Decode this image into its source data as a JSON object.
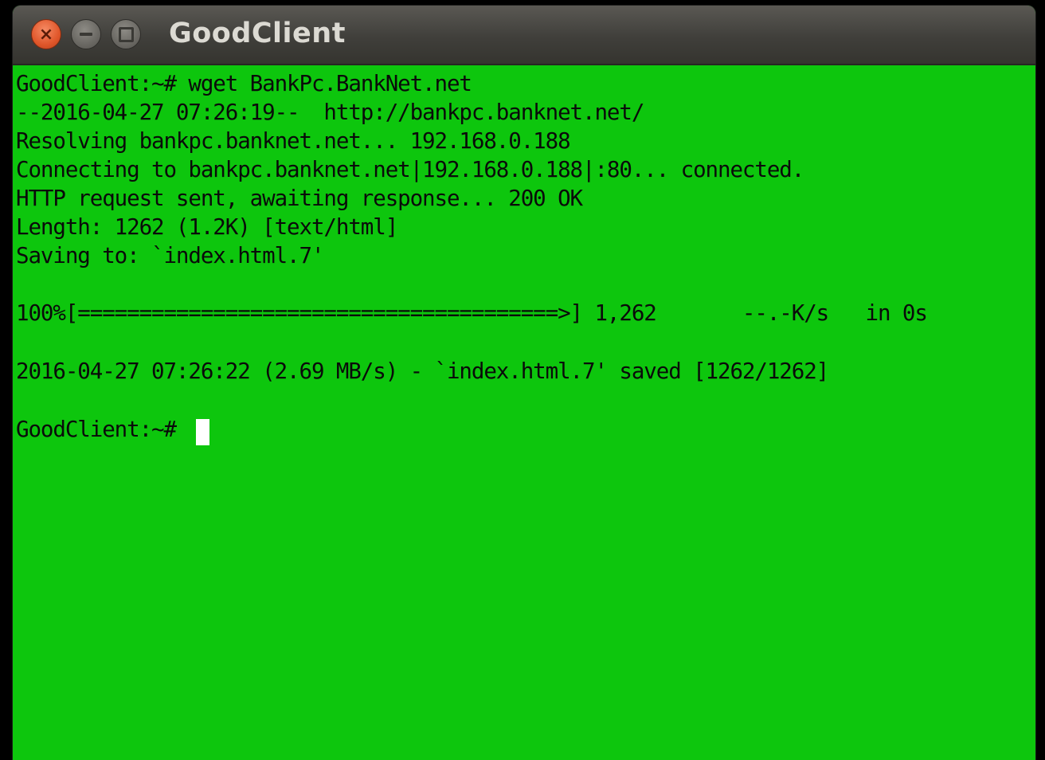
{
  "window": {
    "title": "GoodClient"
  },
  "terminal": {
    "lines": [
      "GoodClient:~# wget BankPc.BankNet.net",
      "--2016-04-27 07:26:19--  http://bankpc.banknet.net/",
      "Resolving bankpc.banknet.net... 192.168.0.188",
      "Connecting to bankpc.banknet.net|192.168.0.188|:80... connected.",
      "HTTP request sent, awaiting response... 200 OK",
      "Length: 1262 (1.2K) [text/html]",
      "Saving to: `index.html.7'",
      "",
      "100%[=======================================>] 1,262       --.-K/s   in 0s",
      "",
      "2016-04-27 07:26:22 (2.69 MB/s) - `index.html.7' saved [1262/1262]",
      "",
      "GoodClient:~# "
    ],
    "download_progress_percent": 100
  },
  "colors": {
    "terminal_background": "#0dc60d",
    "terminal_text": "#0a0a0a",
    "titlebar": "#403f3b",
    "close_button": "#e0562a"
  },
  "icons": {
    "close": "close-icon",
    "minimize": "minimize-icon",
    "maximize": "maximize-icon"
  }
}
